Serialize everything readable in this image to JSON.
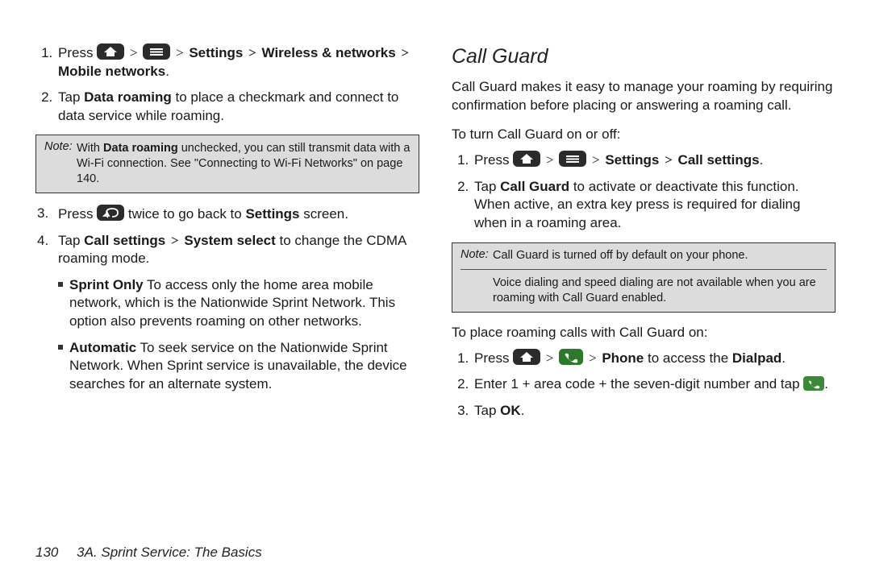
{
  "left": {
    "step1": {
      "press": "Press",
      "path": "Settings",
      "path2": "Wireless & networks",
      "path3": "Mobile networks"
    },
    "step2": {
      "a": "Tap ",
      "b": "Data roaming",
      "c": " to place a checkmark and connect to data service while roaming."
    },
    "note": {
      "label": "Note:",
      "a": "With ",
      "b": "Data roaming",
      "c": " unchecked, you can still transmit data with a Wi-Fi connection. See \"Connecting to Wi-Fi Networks\" on page 140."
    },
    "step3": {
      "a": "Press ",
      "b": " twice to go back to ",
      "c": "Settings",
      "d": " screen."
    },
    "step4": {
      "a": "Tap ",
      "b": "Call settings",
      "c": "System select",
      "d": " to change the CDMA roaming mode."
    },
    "sub1": {
      "label": "Sprint Only",
      "text": " To access only the home area mobile network, which is the Nationwide Sprint Network. This option also prevents roaming on other networks."
    },
    "sub2": {
      "label": "Automatic",
      "text": " To seek service on the Nationwide Sprint Network. When Sprint service is unavailable, the device searches for an alternate system."
    }
  },
  "right": {
    "heading": "Call Guard",
    "intro": "Call Guard makes it easy to manage your roaming by requiring confirmation before placing or answering a roaming call.",
    "sub1": "To turn Call Guard on or off:",
    "s1": {
      "press": "Press",
      "path1": "Settings",
      "path2": "Call settings"
    },
    "s2": {
      "a": "Tap ",
      "b": "Call Guard",
      "c": " to activate or deactivate this function. When active, an extra key press is required for dialing when in a roaming area."
    },
    "note": {
      "label": "Note:",
      "line1": "Call Guard is turned off by default on your phone.",
      "line2": "Voice dialing and speed dialing are not available when you are roaming with Call Guard enabled."
    },
    "sub2": "To place roaming calls with Call Guard on:",
    "p1": {
      "a": "Press ",
      "b": "Phone",
      "c": " to access the ",
      "d": "Dialpad",
      "e": "."
    },
    "p2": {
      "a": "Enter 1 + area code + the seven-digit number and tap ",
      "b": "."
    },
    "p3": {
      "a": "Tap ",
      "b": "OK",
      "c": "."
    }
  },
  "footer": {
    "page": "130",
    "title": "3A. Sprint Service: The Basics"
  },
  "glyph": {
    "gt": ">"
  }
}
